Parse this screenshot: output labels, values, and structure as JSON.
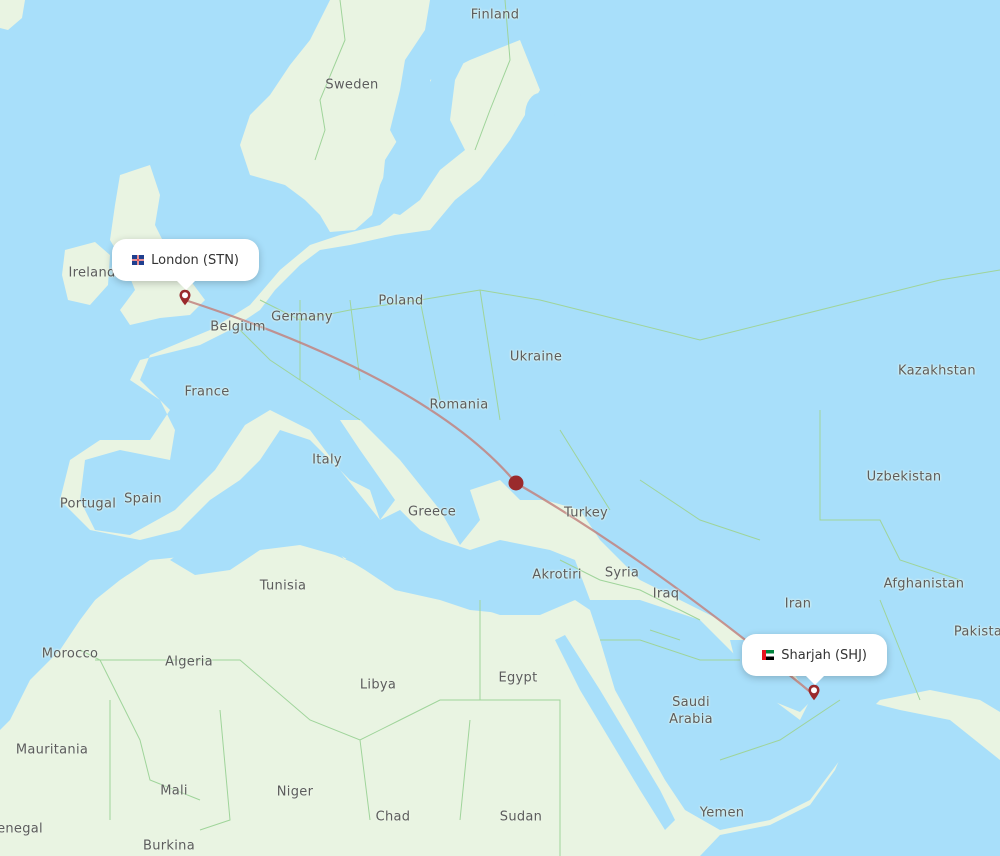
{
  "map": {
    "colors": {
      "sea": "#a8dffa",
      "land": "#e9f4e2",
      "border": "#9fd49a",
      "route": "#c2847f",
      "marker": "#9a2a2c",
      "label": "#5c5c5c"
    },
    "country_labels": [
      {
        "name": "Finland"
      },
      {
        "name": "Sweden"
      },
      {
        "name": "Ireland"
      },
      {
        "name": "Belgium"
      },
      {
        "name": "Germany"
      },
      {
        "name": "Poland"
      },
      {
        "name": "Ukraine"
      },
      {
        "name": "France"
      },
      {
        "name": "Romania"
      },
      {
        "name": "Kazakhstan"
      },
      {
        "name": "Italy"
      },
      {
        "name": "Portugal"
      },
      {
        "name": "Spain"
      },
      {
        "name": "Greece"
      },
      {
        "name": "Turkey"
      },
      {
        "name": "Uzbekistan"
      },
      {
        "name": "Tunisia"
      },
      {
        "name": "Akrotiri"
      },
      {
        "name": "Syria"
      },
      {
        "name": "Afghanistan"
      },
      {
        "name": "Iraq"
      },
      {
        "name": "Iran"
      },
      {
        "name": "Pakista"
      },
      {
        "name": "Morocco"
      },
      {
        "name": "Algeria"
      },
      {
        "name": "Libya"
      },
      {
        "name": "Egypt"
      },
      {
        "name": "Saudi\nArabia"
      },
      {
        "name": "Mauritania"
      },
      {
        "name": "Mali"
      },
      {
        "name": "Niger"
      },
      {
        "name": "Chad"
      },
      {
        "name": "Sudan"
      },
      {
        "name": "Yemen"
      },
      {
        "name": "enegal"
      },
      {
        "name": "Burkina"
      }
    ],
    "origin": {
      "label": "London (STN)",
      "flag": "uk-flag"
    },
    "destination": {
      "label": "Sharjah (SHJ)",
      "flag": "uae-flag"
    },
    "route": {
      "from": "STN",
      "to": "SHJ",
      "midpoint_marker": true
    }
  }
}
